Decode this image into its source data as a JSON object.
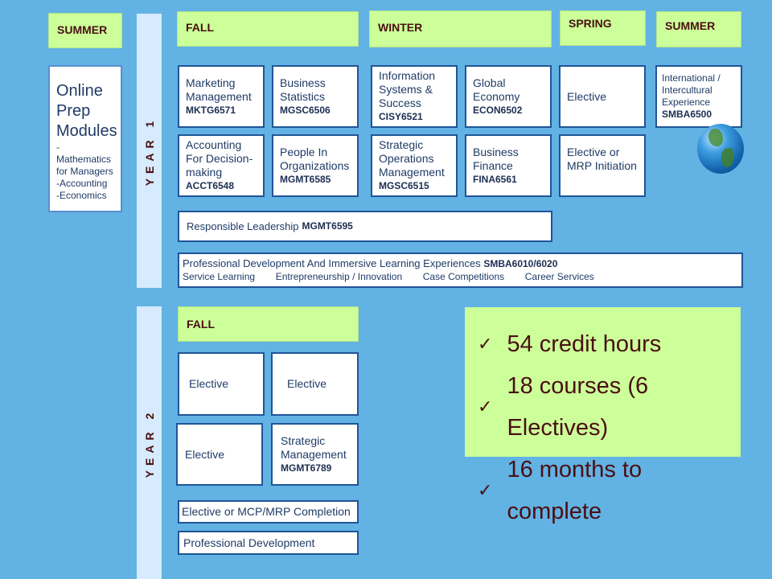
{
  "terms": {
    "summer_pre": "SUMMER",
    "fall": "FALL",
    "winter": "WINTER",
    "spring": "SPRING",
    "summer": "SUMMER",
    "fall_y2": "FALL"
  },
  "years": {
    "year1": "YEAR 1",
    "year2": "YEAR 2"
  },
  "prep": {
    "title_lines": [
      "Online",
      "Prep",
      "Modules"
    ],
    "items": [
      "-Mathematics",
      "for Managers",
      "-Accounting",
      "-Economics"
    ]
  },
  "year1_courses": [
    {
      "name": "Marketing Management",
      "code": "MKTG6571"
    },
    {
      "name": "Business Statistics",
      "code": "MGSC6506"
    },
    {
      "name": "Accounting For Decision-making",
      "code": "ACCT6548"
    },
    {
      "name": "People In Organizations",
      "code": "MGMT6585"
    },
    {
      "name": "Information Systems & Success",
      "code": "CISY6521"
    },
    {
      "name": "Global Economy",
      "code": "ECON6502"
    },
    {
      "name": "Strategic Operations Management",
      "code": "MGSC6515"
    },
    {
      "name": "Business Finance",
      "code": "FINA6561"
    },
    {
      "name": "Elective",
      "code": ""
    },
    {
      "name": "Elective or MRP Initiation",
      "code": ""
    },
    {
      "name": "International / Intercultural Experience",
      "code": "SMBA6500"
    }
  ],
  "responsible_leadership": {
    "name": "Responsible Leadership",
    "code": "MGMT6595"
  },
  "professional_dev": {
    "name": "Professional Development  And Immersive  Learning Experiences",
    "code": "SMBA6010/6020",
    "sub_items": [
      "Service Learning",
      "Entrepreneurship / Innovation",
      "Case Competitions",
      "Career Services"
    ]
  },
  "year2_courses": [
    {
      "name": "Elective",
      "code": ""
    },
    {
      "name": "Elective",
      "code": ""
    },
    {
      "name": "Elective",
      "code": ""
    },
    {
      "name": "Strategic Management",
      "code": "MGMT6789"
    },
    {
      "name": "Elective or MCP/MRP Completion",
      "code": ""
    },
    {
      "name": "Professional  Development",
      "code": ""
    }
  ],
  "summary": {
    "check_icon": "✓",
    "items": [
      "54 credit hours",
      "18 courses (6 Electives)",
      "16 months to complete"
    ]
  },
  "globe_icon": "globe-icon"
}
